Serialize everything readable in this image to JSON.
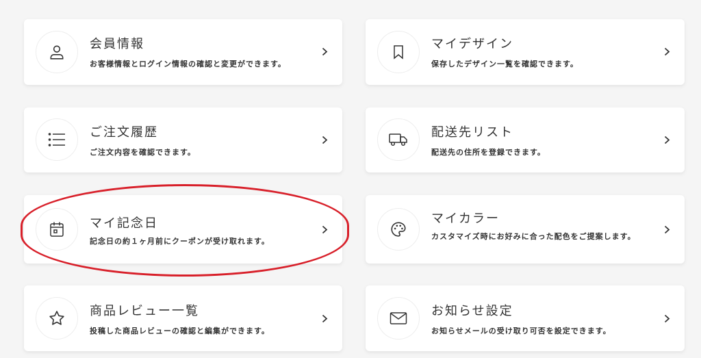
{
  "cards": [
    {
      "id": "member-info",
      "title": "会員情報",
      "desc": "お客様情報とログイン情報の確認と変更ができます。",
      "icon": "user-icon"
    },
    {
      "id": "my-design",
      "title": "マイデザイン",
      "desc": "保存したデザイン一覧を確認できます。",
      "icon": "bookmark-icon"
    },
    {
      "id": "order-history",
      "title": "ご注文履歴",
      "desc": "ご注文内容を確認できます。",
      "icon": "list-icon"
    },
    {
      "id": "shipping-list",
      "title": "配送先リスト",
      "desc": "配送先の住所を登録できます。",
      "icon": "truck-icon"
    },
    {
      "id": "my-anniversary",
      "title": "マイ記念日",
      "desc": "記念日の約１ヶ月前にクーポンが受け取れます。",
      "icon": "calendar-icon"
    },
    {
      "id": "my-color",
      "title": "マイカラー",
      "desc": "カスタマイズ時にお好みに合った配色をご提案します。",
      "icon": "palette-icon"
    },
    {
      "id": "product-reviews",
      "title": "商品レビュー一覧",
      "desc": "投稿した商品レビューの確認と編集ができます。",
      "icon": "star-icon"
    },
    {
      "id": "notification-settings",
      "title": "お知らせ設定",
      "desc": "お知らせメールの受け取り可否を設定できます。",
      "icon": "mail-icon"
    }
  ],
  "highlight": {
    "target": "my-anniversary",
    "color": "#d8202a"
  }
}
